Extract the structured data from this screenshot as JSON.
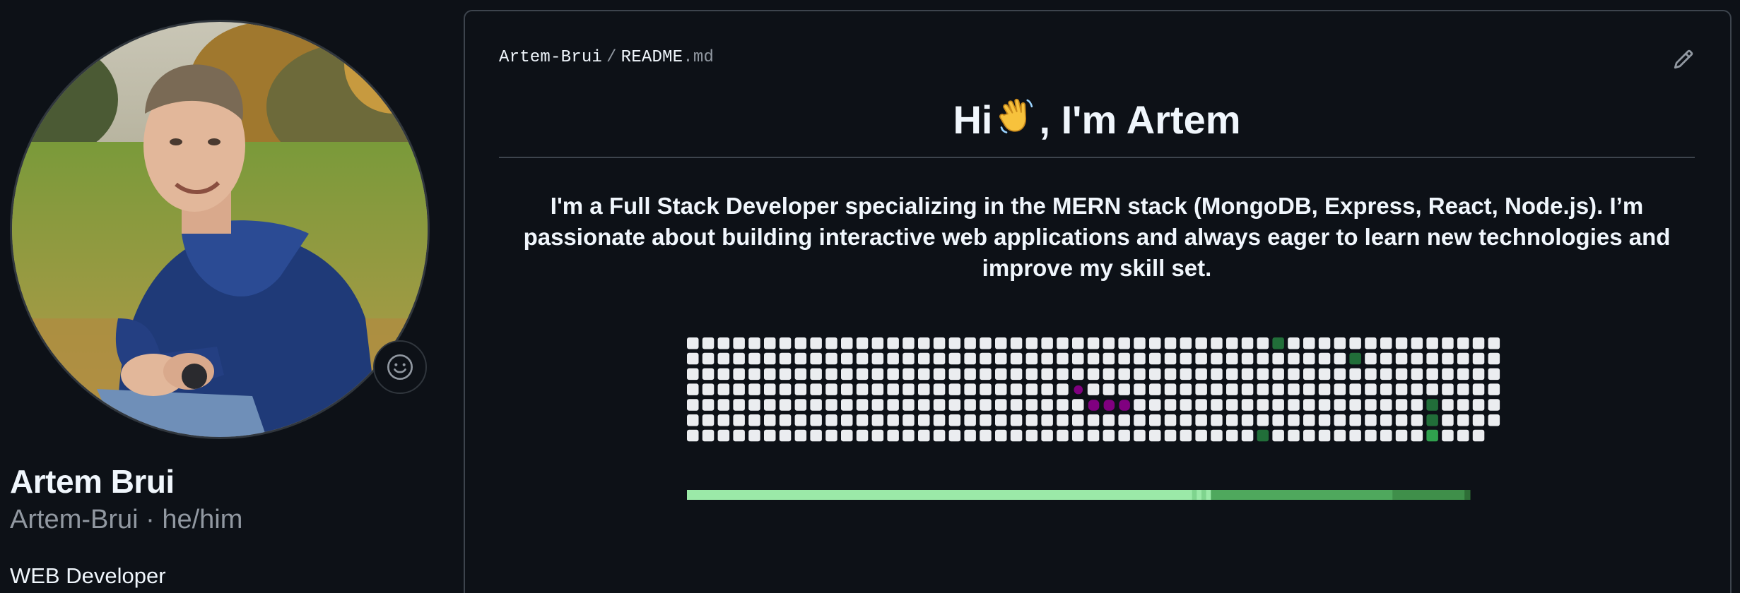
{
  "profile": {
    "full_name": "Artem Brui",
    "username_line": "Artem-Brui · he/him",
    "bio": "WEB Developer",
    "avatar_alt": "Artem Brui"
  },
  "readme": {
    "owner": "Artem-Brui",
    "separator": "/",
    "file_base": "README",
    "file_ext": ".md",
    "greeting_before": "Hi",
    "greeting_after": ", I'm Artem",
    "intro": "I'm a Full Stack Developer specializing in the MERN stack (MongoDB, Express, React, Node.js). I’m passionate about building interactive web applications and always eager to learn new technologies and improve my skill set."
  },
  "snake_graph": {
    "weeks": 53,
    "days": 7,
    "cell_color": "#ebedf0",
    "contribution_colors": [
      "#9be9a8",
      "#40c463",
      "#30a14e",
      "#216e39"
    ],
    "snake_color": "#800080",
    "contributions": [
      {
        "week": 38,
        "day": 0,
        "level": 3
      },
      {
        "week": 43,
        "day": 1,
        "level": 3
      },
      {
        "week": 48,
        "day": 4,
        "level": 3
      },
      {
        "week": 48,
        "day": 5,
        "level": 3
      },
      {
        "week": 37,
        "day": 6,
        "level": 3
      },
      {
        "week": 48,
        "day": 6,
        "level": 2
      }
    ],
    "snake_cells": [
      {
        "week": 25,
        "day": 3
      },
      {
        "week": 26,
        "day": 4
      },
      {
        "week": 27,
        "day": 4
      },
      {
        "week": 28,
        "day": 4
      }
    ],
    "progress_segments": [
      {
        "fraction": 0.645,
        "color": "#9be9a8"
      },
      {
        "fraction": 0.006,
        "color": "#7fd48e"
      },
      {
        "fraction": 0.006,
        "color": "#9be9a8"
      },
      {
        "fraction": 0.006,
        "color": "#7fd48e"
      },
      {
        "fraction": 0.006,
        "color": "#9be9a8"
      },
      {
        "fraction": 0.232,
        "color": "#4fa85d"
      },
      {
        "fraction": 0.092,
        "color": "#3f8f4a"
      },
      {
        "fraction": 0.007,
        "color": "#2e6e36"
      }
    ]
  }
}
